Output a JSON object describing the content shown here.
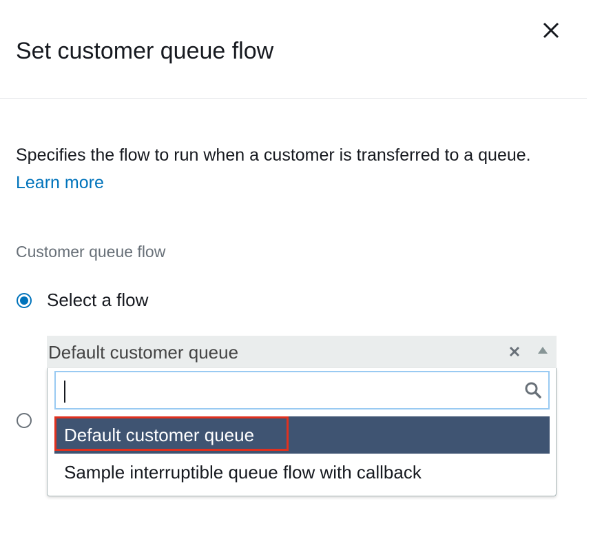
{
  "panel": {
    "title": "Set customer queue flow",
    "close_icon": "close-icon"
  },
  "description": {
    "text": "Specifies the flow to run when a customer is transferred to a queue.",
    "link_label": "Learn more",
    "link_color": "#0073bb"
  },
  "field": {
    "label": "Customer queue flow",
    "radio_select_label": "Select a flow",
    "select": {
      "value": "Default customer queue",
      "clear_icon": "clear-icon",
      "caret_icon": "caret-up-icon"
    },
    "dropdown": {
      "search_placeholder": "",
      "search_icon": "search-icon",
      "options": [
        {
          "label": "Default customer queue",
          "selected": true
        },
        {
          "label": "Sample interruptible queue flow with callback",
          "selected": false
        }
      ]
    }
  },
  "colors": {
    "selected_option_bg": "#3f5472",
    "radio_accent": "#0073bb",
    "annotation_highlight": "#e0311f"
  }
}
